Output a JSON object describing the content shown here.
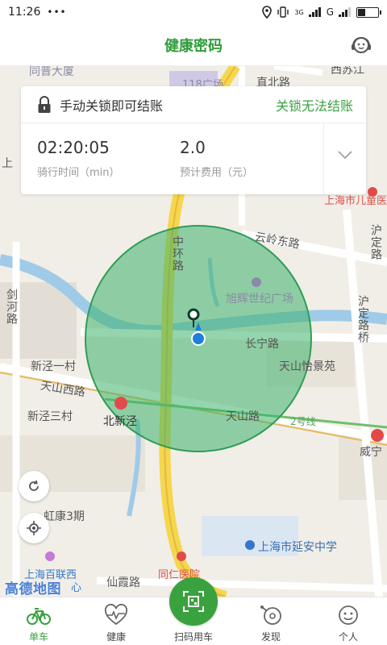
{
  "status_bar": {
    "time": "11:26",
    "dots": "•••",
    "network": "G",
    "signal_label": "3G",
    "battery_level": 0.35
  },
  "header": {
    "title": "健康密码",
    "support_icon": "customer-service-icon"
  },
  "ride_card": {
    "lock_icon": "lock-icon",
    "lock_hint": "手动关锁即可结账",
    "warning_link": "关锁无法结账",
    "ride_time_value": "02:20:05",
    "ride_time_label": "骑行时间（min）",
    "cost_value": "2.0",
    "cost_label": "预计费用（元）"
  },
  "map": {
    "labels": {
      "tongpu": "同普大厦",
      "plaza118": "118广场",
      "zhibei": "直北路",
      "xisuzhou": "西苏江",
      "shang": "上",
      "childrens_hospital": "上海市儿童医",
      "yunling_east": "云岭东路",
      "huchuan": "沪定路",
      "zhonghuan": "中环路",
      "xuhui_plaza": "旭辉世纪广场",
      "jianhe": "剑河路",
      "changning": "长宁路",
      "xinjing1": "新泾一村",
      "tianshan_garden": "天山怡景苑",
      "huding_bridge": "沪定路桥",
      "tianshan_west": "天山西路",
      "xinjing3": "新泾三村",
      "beixinjing": "北新泾",
      "tianshan_road": "天山路",
      "line2": "2号线",
      "weining": "威宁",
      "hongkang": "虹康3期",
      "yanan_school": "上海市延安中学",
      "bailian": "上海百联西",
      "xinheart": "心",
      "xianxia": "仙霞路",
      "tongren": "同仁医院"
    },
    "brand_logo": "高德地图"
  },
  "bottom_nav": {
    "items": [
      {
        "label": "单车",
        "icon": "bike-icon"
      },
      {
        "label": "健康",
        "icon": "heartbeat-icon"
      },
      {
        "label": "扫码用车",
        "icon": "qr-scan-icon"
      },
      {
        "label": "发现",
        "icon": "discover-icon"
      },
      {
        "label": "个人",
        "icon": "smiley-icon"
      }
    ],
    "active_index": 0
  },
  "colors": {
    "brand_green": "#3aa13f",
    "title_green": "#2f9d3a",
    "geofence_fill": "#4cbb7a",
    "location_blue": "#1f7fdc"
  }
}
